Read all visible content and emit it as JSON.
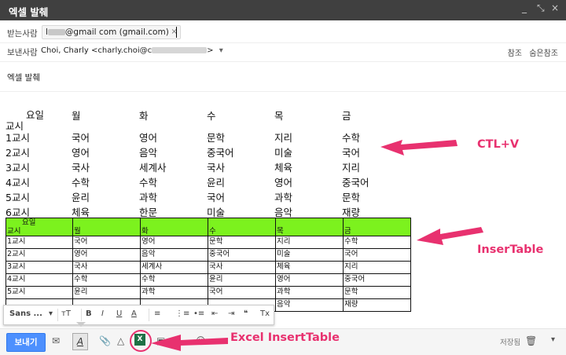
{
  "window": {
    "title": "엑셀 발췌",
    "controls": [
      "_",
      "⤡",
      "×"
    ]
  },
  "to": {
    "label": "받는사람",
    "chip_prefix": "l",
    "chip_text": "@gmail com (gmail.com)",
    "chip_remove": "×"
  },
  "from": {
    "label": "보낸사람",
    "value_prefix": "Choi, Charly <charly.choi@c",
    "value_suffix": ">",
    "dropdown": "▾",
    "cc": "참조",
    "bcc": "숨은참조"
  },
  "subject": "엑셀 발췌",
  "plain_table": {
    "corner_top": "요일",
    "corner_bottom": "교시",
    "days": [
      "월",
      "화",
      "수",
      "목",
      "금"
    ],
    "rows": [
      [
        "1교시",
        "국어",
        "영어",
        "문학",
        "지리",
        "수학"
      ],
      [
        "2교시",
        "영어",
        "음악",
        "중국어",
        "미술",
        "국어"
      ],
      [
        "3교시",
        "국사",
        "세계사",
        "국사",
        "체육",
        "지리"
      ],
      [
        "4교시",
        "수학",
        "수학",
        "윤리",
        "영어",
        "중국어"
      ],
      [
        "5교시",
        "윤리",
        "과학",
        "국어",
        "과학",
        "문학"
      ],
      [
        "6교시",
        "체육",
        "한문",
        "미술",
        "음악",
        "재량"
      ]
    ]
  },
  "grid_table": {
    "corner_top": "요일",
    "corner_bottom": "교시",
    "days": [
      "월",
      "화",
      "수",
      "목",
      "금"
    ],
    "rows": [
      [
        "1교시",
        "국어",
        "영어",
        "문학",
        "지리",
        "수학"
      ],
      [
        "2교시",
        "영어",
        "음악",
        "중국어",
        "미술",
        "국어"
      ],
      [
        "3교시",
        "국사",
        "세계사",
        "국사",
        "체육",
        "지리"
      ],
      [
        "4교시",
        "수학",
        "수학",
        "윤리",
        "영어",
        "중국어"
      ],
      [
        "5교시",
        "윤리",
        "과학",
        "국어",
        "과학",
        "문학"
      ],
      [
        "",
        "",
        "",
        "",
        "음악",
        "재량"
      ]
    ]
  },
  "format_toolbar": {
    "font": "Sans ...",
    "font_caret": "▾",
    "size": "тT",
    "bold": "B",
    "italic": "I",
    "underline": "U",
    "text_color": "A",
    "align": "≡",
    "numbered_list": "⋮≡",
    "bulleted_list": "•≡",
    "indent_less": "⇤",
    "indent_more": "⇥",
    "quote": "❝",
    "clear_format": "Tx"
  },
  "bottom_bar": {
    "send": "보내기",
    "saved": "저장됨",
    "more": "▾",
    "excel_glyph": "X"
  },
  "annotations": {
    "ctlv": "CTL+V",
    "insertable": "InserTable",
    "excel": "Excel InsertTable"
  },
  "colors": {
    "accent": "#e8316f",
    "header_green": "#7cf21e",
    "send_blue": "#4d90fe"
  }
}
